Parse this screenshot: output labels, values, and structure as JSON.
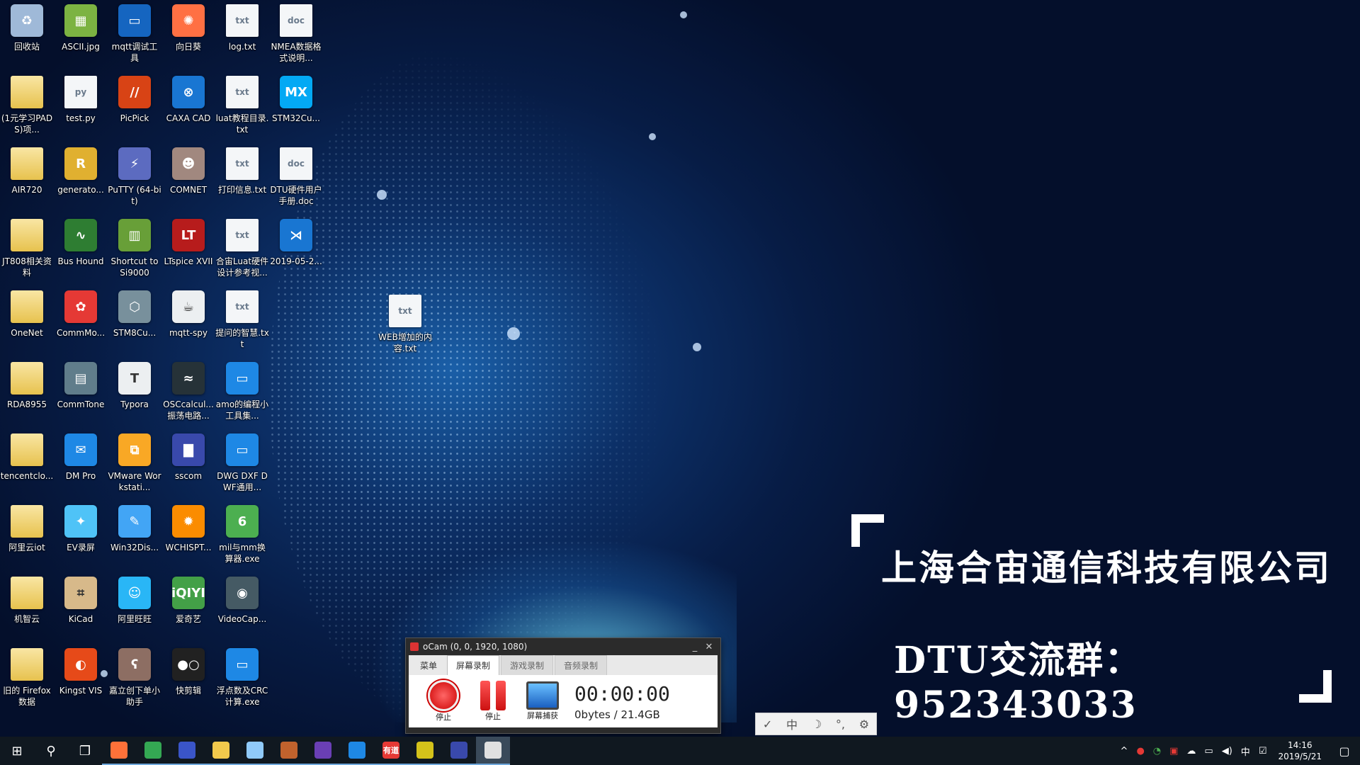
{
  "desktop_icons": [
    {
      "label": "回收站",
      "kind": "recycle",
      "color": "#9fb9d8",
      "glyph": "♻"
    },
    {
      "label": "(1元学习PADS)项...",
      "kind": "folder",
      "color": "",
      "glyph": ""
    },
    {
      "label": "AIR720",
      "kind": "folder",
      "color": "",
      "glyph": ""
    },
    {
      "label": "JT808相关资料",
      "kind": "folder",
      "color": "",
      "glyph": ""
    },
    {
      "label": "OneNet",
      "kind": "folder",
      "color": "",
      "glyph": ""
    },
    {
      "label": "RDA8955",
      "kind": "folder",
      "color": "",
      "glyph": ""
    },
    {
      "label": "tencentclo...",
      "kind": "folder",
      "color": "",
      "glyph": ""
    },
    {
      "label": "阿里云iot",
      "kind": "folder",
      "color": "",
      "glyph": ""
    },
    {
      "label": "机智云",
      "kind": "folder",
      "color": "",
      "glyph": ""
    },
    {
      "label": "旧的 Firefox 数据",
      "kind": "folder",
      "color": "",
      "glyph": ""
    },
    {
      "label": "ASCII.jpg",
      "kind": "app",
      "color": "#7cb342",
      "glyph": "▦"
    },
    {
      "label": "test.py",
      "kind": "doc",
      "color": "",
      "glyph": "py"
    },
    {
      "label": "generato...",
      "kind": "app",
      "color": "#e0b030",
      "glyph": "R"
    },
    {
      "label": "Bus Hound",
      "kind": "app",
      "color": "#2e7d32",
      "glyph": "∿"
    },
    {
      "label": "CommMo...",
      "kind": "app",
      "color": "#e53935",
      "glyph": "✿"
    },
    {
      "label": "CommTone",
      "kind": "app",
      "color": "#607d8b",
      "glyph": "▤"
    },
    {
      "label": "DM Pro",
      "kind": "app",
      "color": "#1e88e5",
      "glyph": "✉"
    },
    {
      "label": "EV录屏",
      "kind": "app",
      "color": "#4fc3f7",
      "glyph": "✦"
    },
    {
      "label": "KiCad",
      "kind": "app",
      "color": "#d7b98a",
      "glyph": "⌗"
    },
    {
      "label": "Kingst VIS",
      "kind": "app",
      "color": "#e64a19",
      "glyph": "◐"
    },
    {
      "label": "mqtt调试工具",
      "kind": "app",
      "color": "#1565c0",
      "glyph": "▭"
    },
    {
      "label": "PicPick",
      "kind": "app",
      "color": "#d84315",
      "glyph": "//"
    },
    {
      "label": "PuTTY (64-bit)",
      "kind": "app",
      "color": "#5c6bc0",
      "glyph": "⚡"
    },
    {
      "label": "Shortcut to Si9000",
      "kind": "app",
      "color": "#689f38",
      "glyph": "▥"
    },
    {
      "label": "STM8Cu...",
      "kind": "app",
      "color": "#78909c",
      "glyph": "⬡"
    },
    {
      "label": "Typora",
      "kind": "app",
      "color": "#eceff1",
      "glyph": "T"
    },
    {
      "label": "VMware Workstati...",
      "kind": "app",
      "color": "#f9a825",
      "glyph": "⧉"
    },
    {
      "label": "Win32Dis...",
      "kind": "app",
      "color": "#42a5f5",
      "glyph": "✎"
    },
    {
      "label": "阿里旺旺",
      "kind": "app",
      "color": "#29b6f6",
      "glyph": "☺"
    },
    {
      "label": "嘉立创下单小助手",
      "kind": "app",
      "color": "#8d6e63",
      "glyph": "ʕ"
    },
    {
      "label": "向日葵",
      "kind": "app",
      "color": "#ff7043",
      "glyph": "✺"
    },
    {
      "label": "CAXA CAD",
      "kind": "app",
      "color": "#1976d2",
      "glyph": "⊗"
    },
    {
      "label": "COMNET",
      "kind": "app",
      "color": "#a1887f",
      "glyph": "☻"
    },
    {
      "label": "LTspice XVII",
      "kind": "app",
      "color": "#b71c1c",
      "glyph": "LT"
    },
    {
      "label": "mqtt-spy",
      "kind": "app",
      "color": "#eceff1",
      "glyph": "☕"
    },
    {
      "label": "OSCcalcul... 振荡电路...",
      "kind": "app",
      "color": "#263238",
      "glyph": "≈"
    },
    {
      "label": "sscom",
      "kind": "app",
      "color": "#3949ab",
      "glyph": "▇"
    },
    {
      "label": "WCHISPT...",
      "kind": "app",
      "color": "#fb8c00",
      "glyph": "✹"
    },
    {
      "label": "爱奇艺",
      "kind": "app",
      "color": "#43a047",
      "glyph": "iQIYI"
    },
    {
      "label": "快剪辑",
      "kind": "app",
      "color": "#212121",
      "glyph": "●○"
    },
    {
      "label": "log.txt",
      "kind": "doc",
      "color": "",
      "glyph": "txt"
    },
    {
      "label": "luat教程目录.txt",
      "kind": "doc",
      "color": "",
      "glyph": "txt"
    },
    {
      "label": "打印信息.txt",
      "kind": "doc",
      "color": "",
      "glyph": "txt"
    },
    {
      "label": "合宙Luat硬件设计参考视...",
      "kind": "doc",
      "color": "",
      "glyph": "txt"
    },
    {
      "label": "提问的智慧.txt",
      "kind": "doc",
      "color": "",
      "glyph": "txt"
    },
    {
      "label": "amo的编程小工具集...",
      "kind": "app",
      "color": "#1e88e5",
      "glyph": "▭"
    },
    {
      "label": "DWG DXF DWF通用...",
      "kind": "app",
      "color": "#1e88e5",
      "glyph": "▭"
    },
    {
      "label": "mil与mm换算器.exe",
      "kind": "app",
      "color": "#4caf50",
      "glyph": "6"
    },
    {
      "label": "VideoCap...",
      "kind": "app",
      "color": "#455a64",
      "glyph": "◉"
    },
    {
      "label": "浮点数及CRC计算.exe",
      "kind": "app",
      "color": "#1e88e5",
      "glyph": "▭"
    },
    {
      "label": "NMEA数据格式说明...",
      "kind": "doc",
      "color": "",
      "glyph": "doc"
    },
    {
      "label": "STM32Cu...",
      "kind": "app",
      "color": "#03a9f4",
      "glyph": "MX"
    },
    {
      "label": "DTU硬件用户手册.doc",
      "kind": "doc",
      "color": "",
      "glyph": "doc"
    },
    {
      "label": "2019-05-2...",
      "kind": "app",
      "color": "#1976d2",
      "glyph": "⋊"
    }
  ],
  "free_icon": {
    "label": "WEB增加的内容.txt",
    "kind": "doc",
    "color": "",
    "glyph": "txt"
  },
  "banner": {
    "company": "上海合宙通信科技有限公司",
    "group": "DTU交流群：952343033"
  },
  "ocam": {
    "title": "oCam (0, 0, 1920, 1080)",
    "minimize": "_",
    "close": "✕",
    "tabs": [
      "菜单",
      "屏幕录制",
      "游戏录制",
      "音频录制"
    ],
    "active_tab": "屏幕录制",
    "tools": [
      {
        "label": "停止"
      },
      {
        "label": "停止"
      },
      {
        "label": "屏幕捕获"
      }
    ],
    "time": "00:00:00",
    "size": "0bytes / 21.4GB"
  },
  "ime_bar": {
    "items": [
      "✓",
      "中",
      "☽",
      "°,",
      "⚙"
    ]
  },
  "taskbar": {
    "start": "⊞",
    "search": "⚲",
    "taskview": "❐",
    "apps": [
      {
        "name": "firefox",
        "color": "#ff7139",
        "text": ""
      },
      {
        "name": "chrome",
        "color": "#34a853",
        "text": ""
      },
      {
        "name": "app-blue",
        "color": "#3a55c8",
        "text": ""
      },
      {
        "name": "explorer",
        "color": "#f2c94c",
        "text": ""
      },
      {
        "name": "notepad",
        "color": "#90caf9",
        "text": ""
      },
      {
        "name": "app-cad",
        "color": "#c0622d",
        "text": ""
      },
      {
        "name": "vscode",
        "color": "#6a3fb5",
        "text": ""
      },
      {
        "name": "mail",
        "color": "#1e88e5",
        "text": ""
      },
      {
        "name": "youdao",
        "color": "#e53935",
        "text": "有道"
      },
      {
        "name": "app-yellow",
        "color": "#d4c21a",
        "text": ""
      },
      {
        "name": "sscom",
        "color": "#3949ab",
        "text": ""
      },
      {
        "name": "ocam",
        "color": "#e0e0e0",
        "text": ""
      }
    ],
    "tray_icons": [
      "^",
      "●",
      "◔",
      "▣",
      "☁",
      "▭",
      "◀)",
      "中",
      "☑"
    ],
    "time": "14:16",
    "date": "2019/5/21",
    "notify": "▢"
  }
}
